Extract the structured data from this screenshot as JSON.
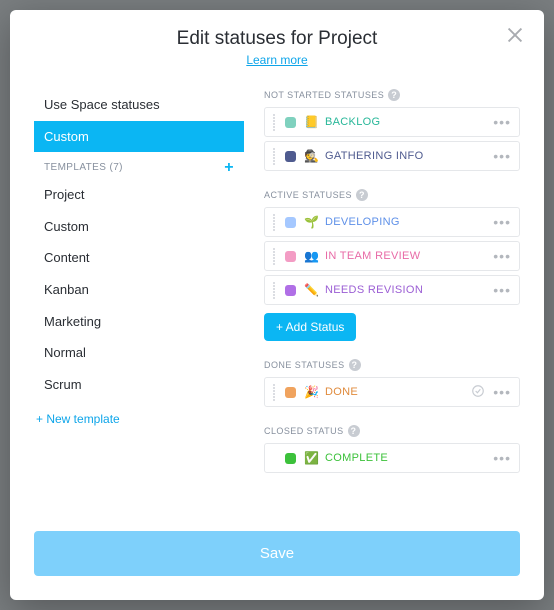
{
  "header": {
    "title": "Edit statuses for Project",
    "learn": "Learn more"
  },
  "left": {
    "use_space": "Use Space statuses",
    "custom": "Custom",
    "templates_label": "TEMPLATES (7)",
    "templates": [
      "Project",
      "Custom",
      "Content",
      "Kanban",
      "Marketing",
      "Normal",
      "Scrum"
    ],
    "new_template": "+ New template"
  },
  "groups": {
    "not_started": {
      "label": "NOT STARTED STATUSES",
      "items": [
        {
          "color": "#7fd1be",
          "emoji": "📒",
          "name": "BACKLOG",
          "text_color": "#28b799"
        },
        {
          "color": "#4f5b8f",
          "emoji": "🕵️",
          "name": "GATHERING INFO",
          "text_color": "#4f5b8f"
        }
      ]
    },
    "active": {
      "label": "ACTIVE STATUSES",
      "items": [
        {
          "color": "#a5c8ff",
          "emoji": "🌱",
          "name": "DEVELOPING",
          "text_color": "#5e90e8"
        },
        {
          "color": "#f39cc4",
          "emoji": "👥",
          "name": "IN TEAM REVIEW",
          "text_color": "#e86aa6"
        },
        {
          "color": "#b06fe6",
          "emoji": "✏️",
          "name": "NEEDS REVISION",
          "text_color": "#9b5ed4"
        }
      ],
      "add": "+ Add Status"
    },
    "done": {
      "label": "DONE STATUSES",
      "items": [
        {
          "color": "#f0a35e",
          "emoji": "🎉",
          "name": "DONE",
          "text_color": "#e08b3d"
        }
      ]
    },
    "closed": {
      "label": "CLOSED STATUS",
      "items": [
        {
          "color": "#3cc13b",
          "emoji": "✅",
          "name": "COMPLETE",
          "text_color": "#3cc13b"
        }
      ]
    }
  },
  "footer": {
    "save": "Save"
  }
}
